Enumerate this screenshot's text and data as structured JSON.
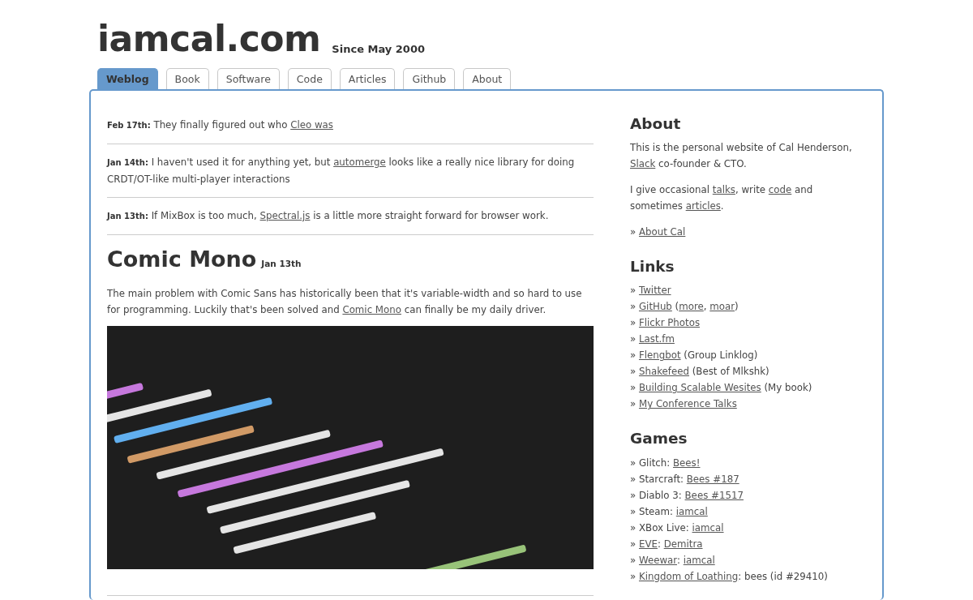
{
  "site": {
    "title": "iamcal.com",
    "tagline": "Since May 2000"
  },
  "tabs": [
    {
      "label": "Weblog",
      "selected": true
    },
    {
      "label": "Book",
      "selected": false
    },
    {
      "label": "Software",
      "selected": false
    },
    {
      "label": "Code",
      "selected": false
    },
    {
      "label": "Articles",
      "selected": false
    },
    {
      "label": "Github",
      "selected": false
    },
    {
      "label": "About",
      "selected": false
    }
  ],
  "posts": [
    {
      "date": "Feb 17th:",
      "parts": [
        {
          "text": " They finally figured out who "
        },
        {
          "text": "Cleo was",
          "link": true
        }
      ]
    },
    {
      "date": "Jan 14th:",
      "parts": [
        {
          "text": " I haven't used it for anything yet, but "
        },
        {
          "text": "automerge",
          "link": true
        },
        {
          "text": " looks like a really nice library for doing CRDT/OT-like multi-player interactions"
        }
      ]
    },
    {
      "date": "Jan 13th:",
      "parts": [
        {
          "text": " If MixBox is too much, "
        },
        {
          "text": "Spectral.js",
          "link": true
        },
        {
          "text": " is a little more straight forward for browser work."
        }
      ]
    }
  ],
  "article": {
    "title": "Comic Mono",
    "date": "Jan 13th",
    "parts": [
      {
        "text": "The main problem with Comic Sans has historically been that it's variable-width and so hard to use for programming. Luckily that's been solved and "
      },
      {
        "text": "Comic Mono",
        "link": true
      },
      {
        "text": " can finally be my daily driver."
      }
    ]
  },
  "sidebar": [
    {
      "heading": "About",
      "blocks": [
        {
          "kind": "paragraph",
          "parts": [
            {
              "text": "This is the personal website of Cal Henderson, "
            },
            {
              "text": "Slack",
              "link": true
            },
            {
              "text": " co-founder & CTO."
            }
          ]
        },
        {
          "kind": "paragraph",
          "parts": [
            {
              "text": "I give occasional "
            },
            {
              "text": "talks",
              "link": true
            },
            {
              "text": ", write "
            },
            {
              "text": "code",
              "link": true
            },
            {
              "text": " and sometimes "
            },
            {
              "text": "articles",
              "link": true
            },
            {
              "text": "."
            }
          ]
        },
        {
          "kind": "paragraph",
          "parts": [
            {
              "text": "» "
            },
            {
              "text": "About Cal",
              "link": true
            }
          ]
        }
      ]
    },
    {
      "heading": "Links",
      "blocks": [
        {
          "kind": "item",
          "parts": [
            {
              "text": "» "
            },
            {
              "text": "Twitter",
              "link": true
            }
          ]
        },
        {
          "kind": "item",
          "parts": [
            {
              "text": "» "
            },
            {
              "text": "GitHub",
              "link": true
            },
            {
              "text": " ("
            },
            {
              "text": "more",
              "link": true
            },
            {
              "text": ", "
            },
            {
              "text": "moar",
              "link": true
            },
            {
              "text": ")"
            }
          ]
        },
        {
          "kind": "item",
          "parts": [
            {
              "text": "» "
            },
            {
              "text": "Flickr Photos",
              "link": true
            }
          ]
        },
        {
          "kind": "item",
          "parts": [
            {
              "text": "» "
            },
            {
              "text": "Last.fm",
              "link": true
            }
          ]
        },
        {
          "kind": "item",
          "parts": [
            {
              "text": "» "
            },
            {
              "text": "Flengbot",
              "link": true
            },
            {
              "text": " (Group Linklog)"
            }
          ]
        },
        {
          "kind": "item",
          "parts": [
            {
              "text": "» "
            },
            {
              "text": "Shakefeed",
              "link": true
            },
            {
              "text": " (Best of Mlkshk)"
            }
          ]
        },
        {
          "kind": "item",
          "parts": [
            {
              "text": "» "
            },
            {
              "text": "Building Scalable Wesites",
              "link": true
            },
            {
              "text": " (My book)"
            }
          ]
        },
        {
          "kind": "item",
          "parts": [
            {
              "text": "» "
            },
            {
              "text": "My Conference Talks",
              "link": true
            }
          ]
        }
      ]
    },
    {
      "heading": "Games",
      "blocks": [
        {
          "kind": "item",
          "parts": [
            {
              "text": "» Glitch: "
            },
            {
              "text": "Bees!",
              "link": true
            }
          ]
        },
        {
          "kind": "item",
          "parts": [
            {
              "text": "» Starcraft: "
            },
            {
              "text": "Bees #187",
              "link": true
            }
          ]
        },
        {
          "kind": "item",
          "parts": [
            {
              "text": "» Diablo 3: "
            },
            {
              "text": "Bees #1517",
              "link": true
            }
          ]
        },
        {
          "kind": "item",
          "parts": [
            {
              "text": "» Steam: "
            },
            {
              "text": "iamcal",
              "link": true
            }
          ]
        },
        {
          "kind": "item",
          "parts": [
            {
              "text": "» XBox Live: "
            },
            {
              "text": "iamcal",
              "link": true
            }
          ]
        },
        {
          "kind": "item",
          "parts": [
            {
              "text": "» "
            },
            {
              "text": "EVE",
              "link": true
            },
            {
              "text": ": "
            },
            {
              "text": "Demitra",
              "link": true
            }
          ]
        },
        {
          "kind": "item",
          "parts": [
            {
              "text": "» "
            },
            {
              "text": "Weewar",
              "link": true
            },
            {
              "text": ": "
            },
            {
              "text": "iamcal",
              "link": true
            }
          ]
        },
        {
          "kind": "item",
          "parts": [
            {
              "text": "» "
            },
            {
              "text": "Kingdom of Loathing",
              "link": true
            },
            {
              "text": ": bees (id #29410)"
            }
          ]
        }
      ]
    }
  ]
}
